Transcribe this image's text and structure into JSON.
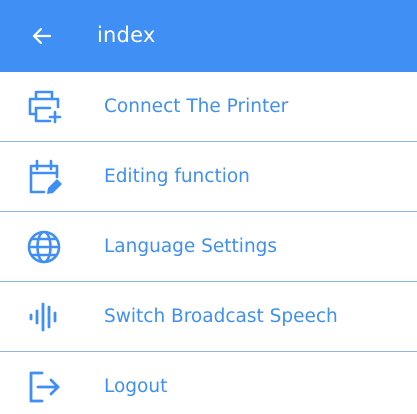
{
  "header": {
    "title": "index",
    "back_icon": "arrow-left-icon"
  },
  "colors": {
    "accent": "#3f8ff4",
    "divider": "#8cb7ea",
    "header_text": "#ffffff"
  },
  "menu": {
    "items": [
      {
        "label": "Connect The Printer",
        "icon": "printer-icon"
      },
      {
        "label": "Editing function",
        "icon": "calendar-edit-icon"
      },
      {
        "label": "Language Settings",
        "icon": "globe-icon"
      },
      {
        "label": "Switch Broadcast Speech",
        "icon": "voice-wave-icon"
      },
      {
        "label": "Logout",
        "icon": "logout-icon"
      }
    ]
  }
}
